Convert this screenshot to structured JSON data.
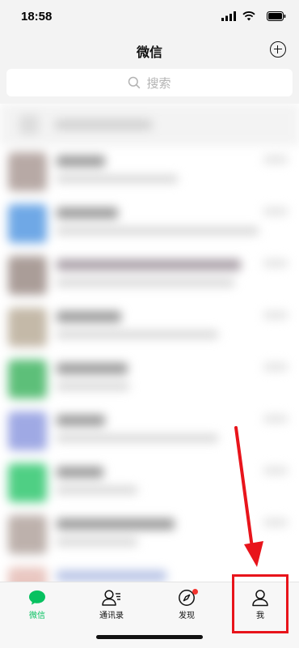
{
  "status_bar": {
    "time": "18:58"
  },
  "nav": {
    "title": "微信"
  },
  "search": {
    "placeholder": "搜索"
  },
  "tabs": [
    {
      "label": "微信",
      "icon": "chat-bubble-icon",
      "active": true
    },
    {
      "label": "通讯录",
      "icon": "contacts-icon",
      "active": false
    },
    {
      "label": "发现",
      "icon": "compass-icon",
      "active": false,
      "badge_dot": true
    },
    {
      "label": "我",
      "icon": "person-icon",
      "active": false
    }
  ],
  "colors": {
    "accent": "#07c160",
    "annotation_red": "#e8141b",
    "badge_red": "#f43530",
    "bar_background": "#f3f3f3"
  }
}
